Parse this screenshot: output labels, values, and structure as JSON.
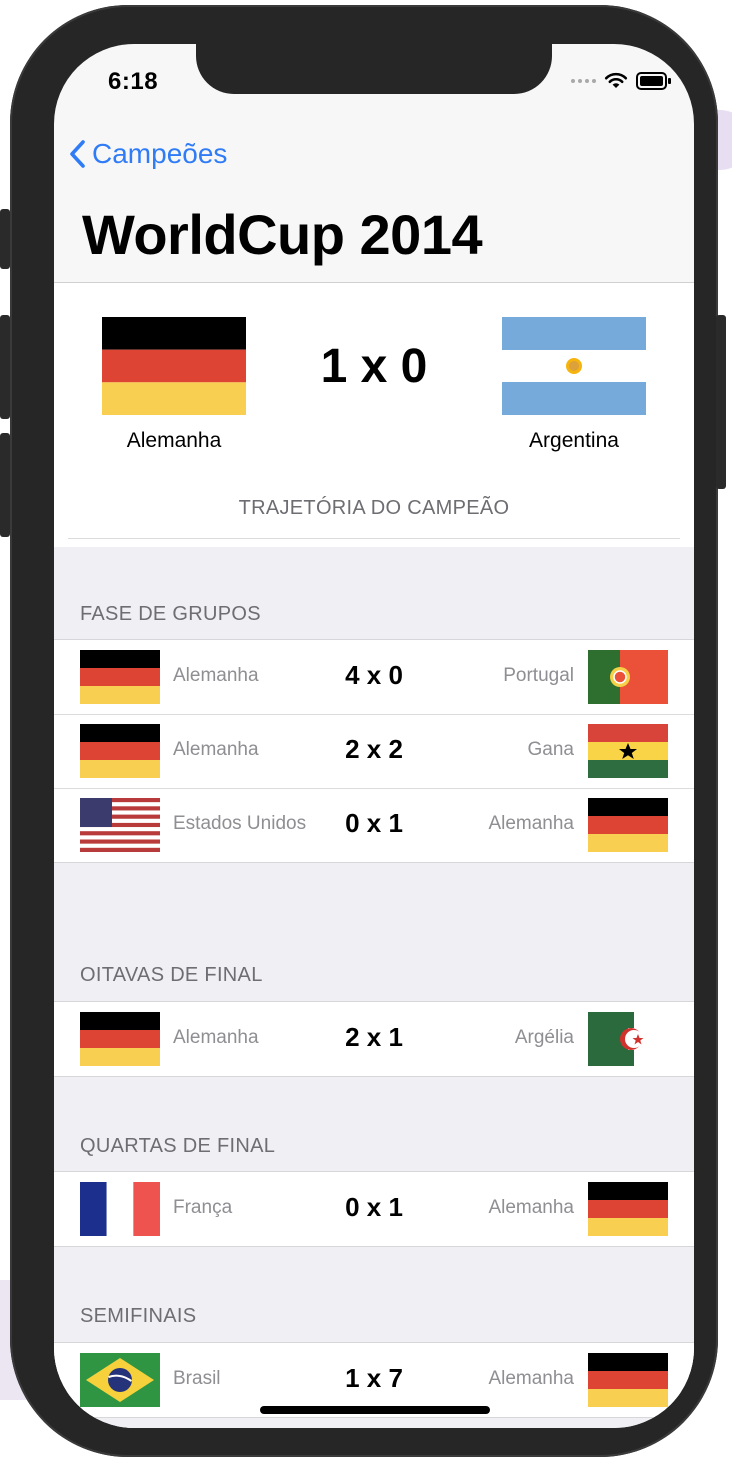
{
  "status": {
    "time": "6:18"
  },
  "nav": {
    "back_label": "Campeões",
    "title": "WorldCup 2014"
  },
  "final": {
    "home": {
      "name": "Alemanha",
      "flag": "germany-flag"
    },
    "away": {
      "name": "Argentina",
      "flag": "argentina-flag"
    },
    "score": "1 x 0",
    "subtitle": "TRAJETÓRIA DO CAMPEÃO"
  },
  "sections": [
    {
      "title": "FASE DE GRUPOS",
      "matches": [
        {
          "home": "Alemanha",
          "home_flag": "germany-flag",
          "score": "4 x 0",
          "away": "Portugal",
          "away_flag": "portugal-flag"
        },
        {
          "home": "Alemanha",
          "home_flag": "germany-flag",
          "score": "2 x 2",
          "away": "Gana",
          "away_flag": "ghana-flag"
        },
        {
          "home": "Estados Unidos",
          "home_flag": "usa-flag",
          "score": "0 x 1",
          "away": "Alemanha",
          "away_flag": "germany-flag"
        }
      ]
    },
    {
      "title": "OITAVAS DE FINAL",
      "matches": [
        {
          "home": "Alemanha",
          "home_flag": "germany-flag",
          "score": "2 x 1",
          "away": "Argélia",
          "away_flag": "algeria-flag"
        }
      ]
    },
    {
      "title": "QUARTAS DE FINAL",
      "matches": [
        {
          "home": "França",
          "home_flag": "france-flag",
          "score": "0 x 1",
          "away": "Alemanha",
          "away_flag": "germany-flag"
        }
      ]
    },
    {
      "title": "SEMIFINAIS",
      "matches": [
        {
          "home": "Brasil",
          "home_flag": "brazil-flag",
          "score": "1 x 7",
          "away": "Alemanha",
          "away_flag": "germany-flag"
        }
      ]
    }
  ],
  "colors": {
    "accent": "#2f7cf6",
    "section_text": "#6d6d72",
    "team_text": "#8e8e93"
  }
}
